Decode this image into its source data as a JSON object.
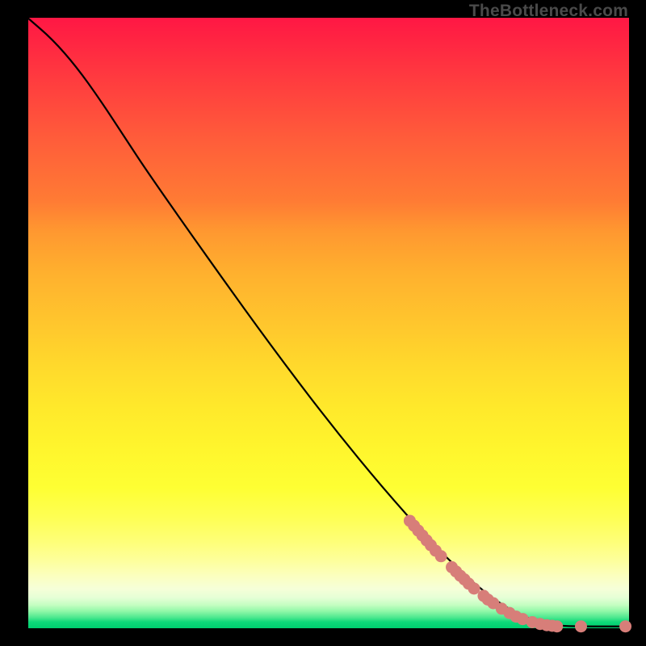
{
  "watermark": "TheBottleneck.com",
  "chart_data": {
    "type": "line",
    "title": "",
    "xlabel": "",
    "ylabel": "",
    "xlim": [
      0,
      100
    ],
    "ylim": [
      0,
      100
    ],
    "curve": [
      {
        "x": 0.0,
        "y": 99.9
      },
      {
        "x": 4.0,
        "y": 96.5
      },
      {
        "x": 8.0,
        "y": 92.0
      },
      {
        "x": 12.0,
        "y": 86.5
      },
      {
        "x": 16.0,
        "y": 80.5
      },
      {
        "x": 20.0,
        "y": 74.5
      },
      {
        "x": 30.0,
        "y": 60.5
      },
      {
        "x": 40.0,
        "y": 46.8
      },
      {
        "x": 50.0,
        "y": 33.8
      },
      {
        "x": 60.0,
        "y": 21.8
      },
      {
        "x": 70.0,
        "y": 11.0
      },
      {
        "x": 78.0,
        "y": 4.2
      },
      {
        "x": 84.0,
        "y": 1.2
      },
      {
        "x": 88.0,
        "y": 0.4
      },
      {
        "x": 92.0,
        "y": 0.3
      },
      {
        "x": 96.0,
        "y": 0.3
      },
      {
        "x": 99.8,
        "y": 0.3
      }
    ],
    "points_cluster": [
      {
        "x": 63.5,
        "y": 17.6
      },
      {
        "x": 64.2,
        "y": 16.8
      },
      {
        "x": 64.9,
        "y": 16.0
      },
      {
        "x": 65.6,
        "y": 15.2
      },
      {
        "x": 66.3,
        "y": 14.4
      },
      {
        "x": 67.0,
        "y": 13.6
      },
      {
        "x": 67.8,
        "y": 12.7
      },
      {
        "x": 68.7,
        "y": 11.8
      },
      {
        "x": 70.5,
        "y": 10.0
      },
      {
        "x": 71.2,
        "y": 9.3
      },
      {
        "x": 71.9,
        "y": 8.6
      },
      {
        "x": 72.6,
        "y": 8.0
      },
      {
        "x": 73.3,
        "y": 7.3
      },
      {
        "x": 74.2,
        "y": 6.5
      },
      {
        "x": 75.8,
        "y": 5.3
      },
      {
        "x": 76.5,
        "y": 4.7
      },
      {
        "x": 77.4,
        "y": 4.1
      },
      {
        "x": 78.8,
        "y": 3.2
      },
      {
        "x": 80.1,
        "y": 2.5
      },
      {
        "x": 81.2,
        "y": 1.9
      },
      {
        "x": 82.3,
        "y": 1.5
      },
      {
        "x": 83.9,
        "y": 1.0
      },
      {
        "x": 85.2,
        "y": 0.7
      },
      {
        "x": 86.3,
        "y": 0.5
      },
      {
        "x": 87.2,
        "y": 0.4
      },
      {
        "x": 88.0,
        "y": 0.3
      },
      {
        "x": 92.0,
        "y": 0.3
      },
      {
        "x": 99.4,
        "y": 0.3
      }
    ]
  }
}
